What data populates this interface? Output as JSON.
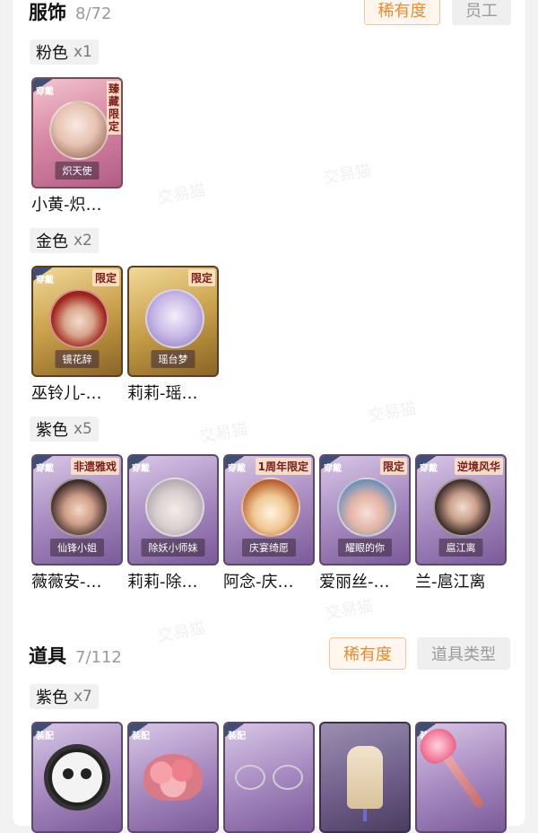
{
  "sections": {
    "costume": {
      "title": "服饰",
      "count": "8/72",
      "btn_rarity": "稀有度",
      "btn_employee": "员工",
      "groups": [
        {
          "rarity": "粉色",
          "mult": "x1",
          "items": [
            {
              "corner": "穿戴",
              "tag": "臻藏限定",
              "plate": "炽天使",
              "caption": "小黄-炽…",
              "color": "pink",
              "figure": "figure"
            }
          ]
        },
        {
          "rarity": "金色",
          "mult": "x2",
          "items": [
            {
              "corner": "穿戴",
              "tag": "限定",
              "plate": "镜花辞",
              "caption": "巫铃儿-…",
              "color": "gold",
              "figure": "hood"
            },
            {
              "corner": "",
              "tag": "限定",
              "plate": "瑶台梦",
              "caption": "莉莉-瑶…",
              "color": "gold",
              "figure": "lilac"
            }
          ]
        },
        {
          "rarity": "紫色",
          "mult": "x5",
          "items": [
            {
              "corner": "穿戴",
              "tag": "非遗雅戏",
              "plate": "仙锋小姐",
              "caption": "薇薇安-…",
              "color": "purple",
              "figure": "hair"
            },
            {
              "corner": "穿戴",
              "tag": "",
              "plate": "除妖小师妹",
              "caption": "莉莉-除…",
              "color": "purple",
              "figure": "silver"
            },
            {
              "corner": "穿戴",
              "tag": "1周年限定",
              "plate": "庆宴绮愿",
              "caption": "阿念-庆…",
              "color": "purple",
              "figure": "cake"
            },
            {
              "corner": "穿戴",
              "tag": "限定",
              "plate": "耀眼的你",
              "caption": "爱丽丝-…",
              "color": "purple",
              "figure": "hat"
            },
            {
              "corner": "穿戴",
              "tag": "逆境风华",
              "plate": "扈江离",
              "caption": "兰-扈江离",
              "color": "purple",
              "figure": "long"
            }
          ]
        }
      ]
    },
    "props": {
      "title": "道具",
      "count": "7/112",
      "btn_rarity": "稀有度",
      "btn_type": "道具类型",
      "groups": [
        {
          "rarity": "紫色",
          "mult": "x7",
          "items": [
            {
              "corner": "装配",
              "shape": "skull",
              "color": "purple"
            },
            {
              "corner": "装配",
              "shape": "bouquet",
              "color": "purple"
            },
            {
              "corner": "装配",
              "shape": "glasses",
              "color": "purple"
            },
            {
              "corner": "",
              "shape": "cat",
              "color": "dark"
            },
            {
              "corner": "装配",
              "shape": "wand",
              "color": "purple"
            }
          ]
        }
      ]
    }
  },
  "watermark": "交易猫"
}
